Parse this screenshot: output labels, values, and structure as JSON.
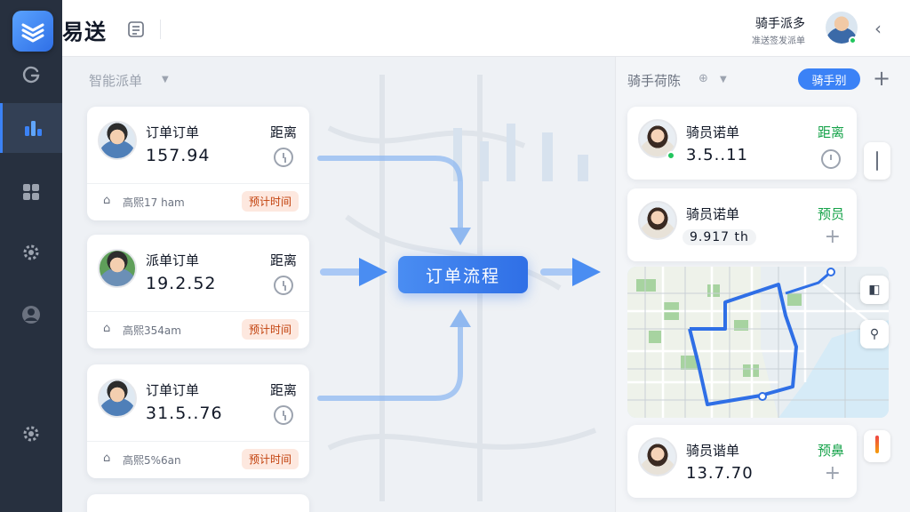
{
  "app": {
    "title": "易送"
  },
  "header": {
    "user_name": "骑手派多",
    "user_sub": "准送签发派单",
    "back_icon": "chevron-left-icon"
  },
  "sidebar": {
    "icons": [
      "logo-icon",
      "refresh-icon",
      "chart-icon",
      "grid-icon",
      "settings-icon",
      "user-icon",
      "settings-icon"
    ]
  },
  "main": {
    "section_title": "智能派单",
    "order_cards": [
      {
        "title": "订单订单",
        "value": "157.94",
        "distance_label": "距离",
        "footer": "高熙17 ham",
        "badge": "预计时间"
      },
      {
        "title": "派单订单",
        "value": "19.2.52",
        "distance_label": "距离",
        "footer": "高熙354am",
        "badge": "预计时间"
      },
      {
        "title": "订单订单",
        "value": "31.5..76",
        "distance_label": "距离",
        "footer": "高熙5%6an",
        "badge": "预计时间"
      }
    ],
    "flow_label": "订单流程"
  },
  "right_panel": {
    "title": "骑手荷陈",
    "button_label": "骑手别",
    "rider_cards": [
      {
        "title": "骑员诺单",
        "value": "3.5..11",
        "status": "距离",
        "status_color": "#16a34a"
      },
      {
        "title": "骑员诺单",
        "value": "9.917 th",
        "status": "预员",
        "status_color": "#16a34a"
      },
      {
        "title": "骑员谐单",
        "value": "13.7.70",
        "status": "预鼻",
        "status_color": "#16a34a"
      }
    ]
  },
  "colors": {
    "accent": "#3b82f6",
    "sidebar": "#27303f",
    "badge_bg": "#fde8df",
    "badge_text": "#c2410c"
  }
}
